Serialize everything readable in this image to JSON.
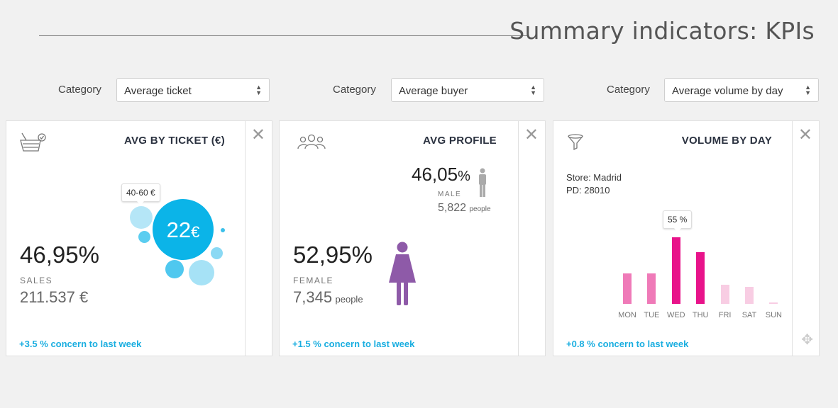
{
  "header": {
    "title": "Summary indicators: KPIs"
  },
  "filters": [
    {
      "label": "Category",
      "value": "Average ticket"
    },
    {
      "label": "Category",
      "value": "Average buyer"
    },
    {
      "label": "Category",
      "value": "Average volume by day"
    }
  ],
  "card1": {
    "title": "AVG BY TICKET (€)",
    "percent": "46,95",
    "percent_sign": "%",
    "label": "SALES",
    "amount": "211.537 €",
    "bubble_value": "22",
    "bubble_unit": "€",
    "tooltip": "40-60 €",
    "footer": "+3.5 % concern to last week",
    "icon": "basket-icon",
    "accent": "#0bb4e8"
  },
  "card2": {
    "title": "AVG PROFILE",
    "male_percent": "46,05",
    "male_sign": "%",
    "male_label": "MALE",
    "male_count": "5,822",
    "male_unit": "people",
    "female_percent": "52,95",
    "female_sign": "%",
    "female_label": "FEMALE",
    "female_count": "7,345",
    "female_unit": "people",
    "footer": "+1.5 % concern to last week",
    "icon": "people-icon",
    "female_color": "#8e5aa8",
    "male_color": "#aaaaaa"
  },
  "card3": {
    "title": "VOLUME BY DAY",
    "store": "Store: Madrid",
    "pd": "PD: 28010",
    "tooltip": "55 %",
    "footer": "+0.8 % concern to last week",
    "icon": "funnel-icon"
  },
  "chart_data": {
    "type": "bar",
    "categories": [
      "MON",
      "TUE",
      "WED",
      "THU",
      "FRI",
      "SAT",
      "SUN"
    ],
    "values": [
      25,
      25,
      55,
      43,
      16,
      14,
      1
    ],
    "colors": [
      "#ef7ab8",
      "#ef7ab8",
      "#e8138a",
      "#e8138a",
      "#f8cde3",
      "#f8cde3",
      "#f8cde3"
    ],
    "annotations": [
      {
        "category": "WED",
        "text": "55 %"
      }
    ],
    "ylim": [
      0,
      55
    ],
    "grid": false
  }
}
